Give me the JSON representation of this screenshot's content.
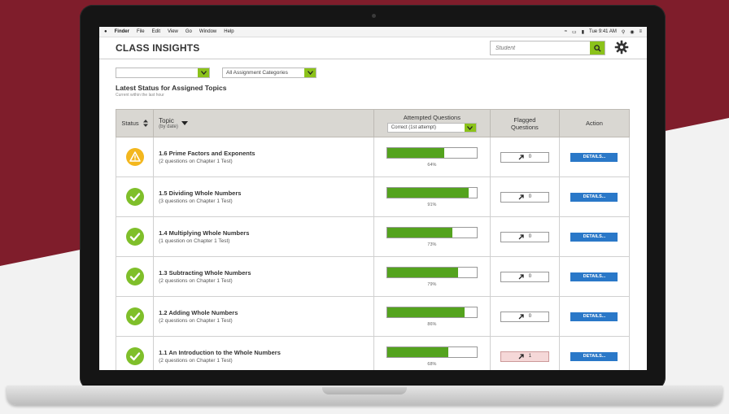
{
  "menubar": {
    "items": [
      "Finder",
      "File",
      "Edit",
      "View",
      "Go",
      "Window",
      "Help"
    ],
    "clock": "Tue 9:41 AM"
  },
  "header": {
    "title": "CLASS INSIGHTS",
    "search_placeholder": "Student"
  },
  "filters": {
    "first_value": "",
    "category_value": "All Assignment Categories"
  },
  "section": {
    "title": "Latest Status for Assigned Topics",
    "subtitle": "Current within the last hour"
  },
  "table": {
    "headers": {
      "status": "Status",
      "topic": "Topic",
      "topic_sub": "(by date)",
      "attempted": "Attempted Questions",
      "attempted_select": "Correct (1st attempt)",
      "flagged_line1": "Flagged",
      "flagged_line2": "Questions",
      "action": "Action"
    },
    "rows": [
      {
        "status": "warning",
        "name": "1.6 Prime Factors and Exponents",
        "sub": "(2 questions on Chapter 1 Test)",
        "percent": 64,
        "percent_label": "64%",
        "flags": "0",
        "flagged": false,
        "action": "DETAILS..."
      },
      {
        "status": "ok",
        "name": "1.5 Dividing Whole Numbers",
        "sub": "(3 questions on Chapter 1 Test)",
        "percent": 91,
        "percent_label": "91%",
        "flags": "0",
        "flagged": false,
        "action": "DETAILS..."
      },
      {
        "status": "ok",
        "name": "1.4 Multiplying Whole Numbers",
        "sub": "(1 question on Chapter 1 Test)",
        "percent": 73,
        "percent_label": "73%",
        "flags": "0",
        "flagged": false,
        "action": "DETAILS..."
      },
      {
        "status": "ok",
        "name": "1.3 Subtracting Whole Numbers",
        "sub": "(2 questions on Chapter 1 Test)",
        "percent": 79,
        "percent_label": "79%",
        "flags": "0",
        "flagged": false,
        "action": "DETAILS..."
      },
      {
        "status": "ok",
        "name": "1.2 Adding Whole Numbers",
        "sub": "(2 questions on Chapter 1 Test)",
        "percent": 86,
        "percent_label": "86%",
        "flags": "0",
        "flagged": false,
        "action": "DETAILS..."
      },
      {
        "status": "ok",
        "name": "1.1 An Introduction to the Whole Numbers",
        "sub": "(2 questions on Chapter 1 Test)",
        "percent": 68,
        "percent_label": "68%",
        "flags": "1",
        "flagged": true,
        "action": "DETAILS..."
      }
    ]
  },
  "colors": {
    "accent_green": "#8bc21a",
    "bar_green": "#54a31e",
    "button_blue": "#2a78c8",
    "warning_yellow": "#f3b71e",
    "ok_green": "#7fbf2a",
    "brand_maroon": "#7f1d2b"
  },
  "icons": {
    "status_warning": "warning-triangle-icon",
    "status_ok": "check-circle-icon",
    "search": "search-icon",
    "settings": "gear-icon",
    "flag": "arrow-up-right-icon"
  }
}
